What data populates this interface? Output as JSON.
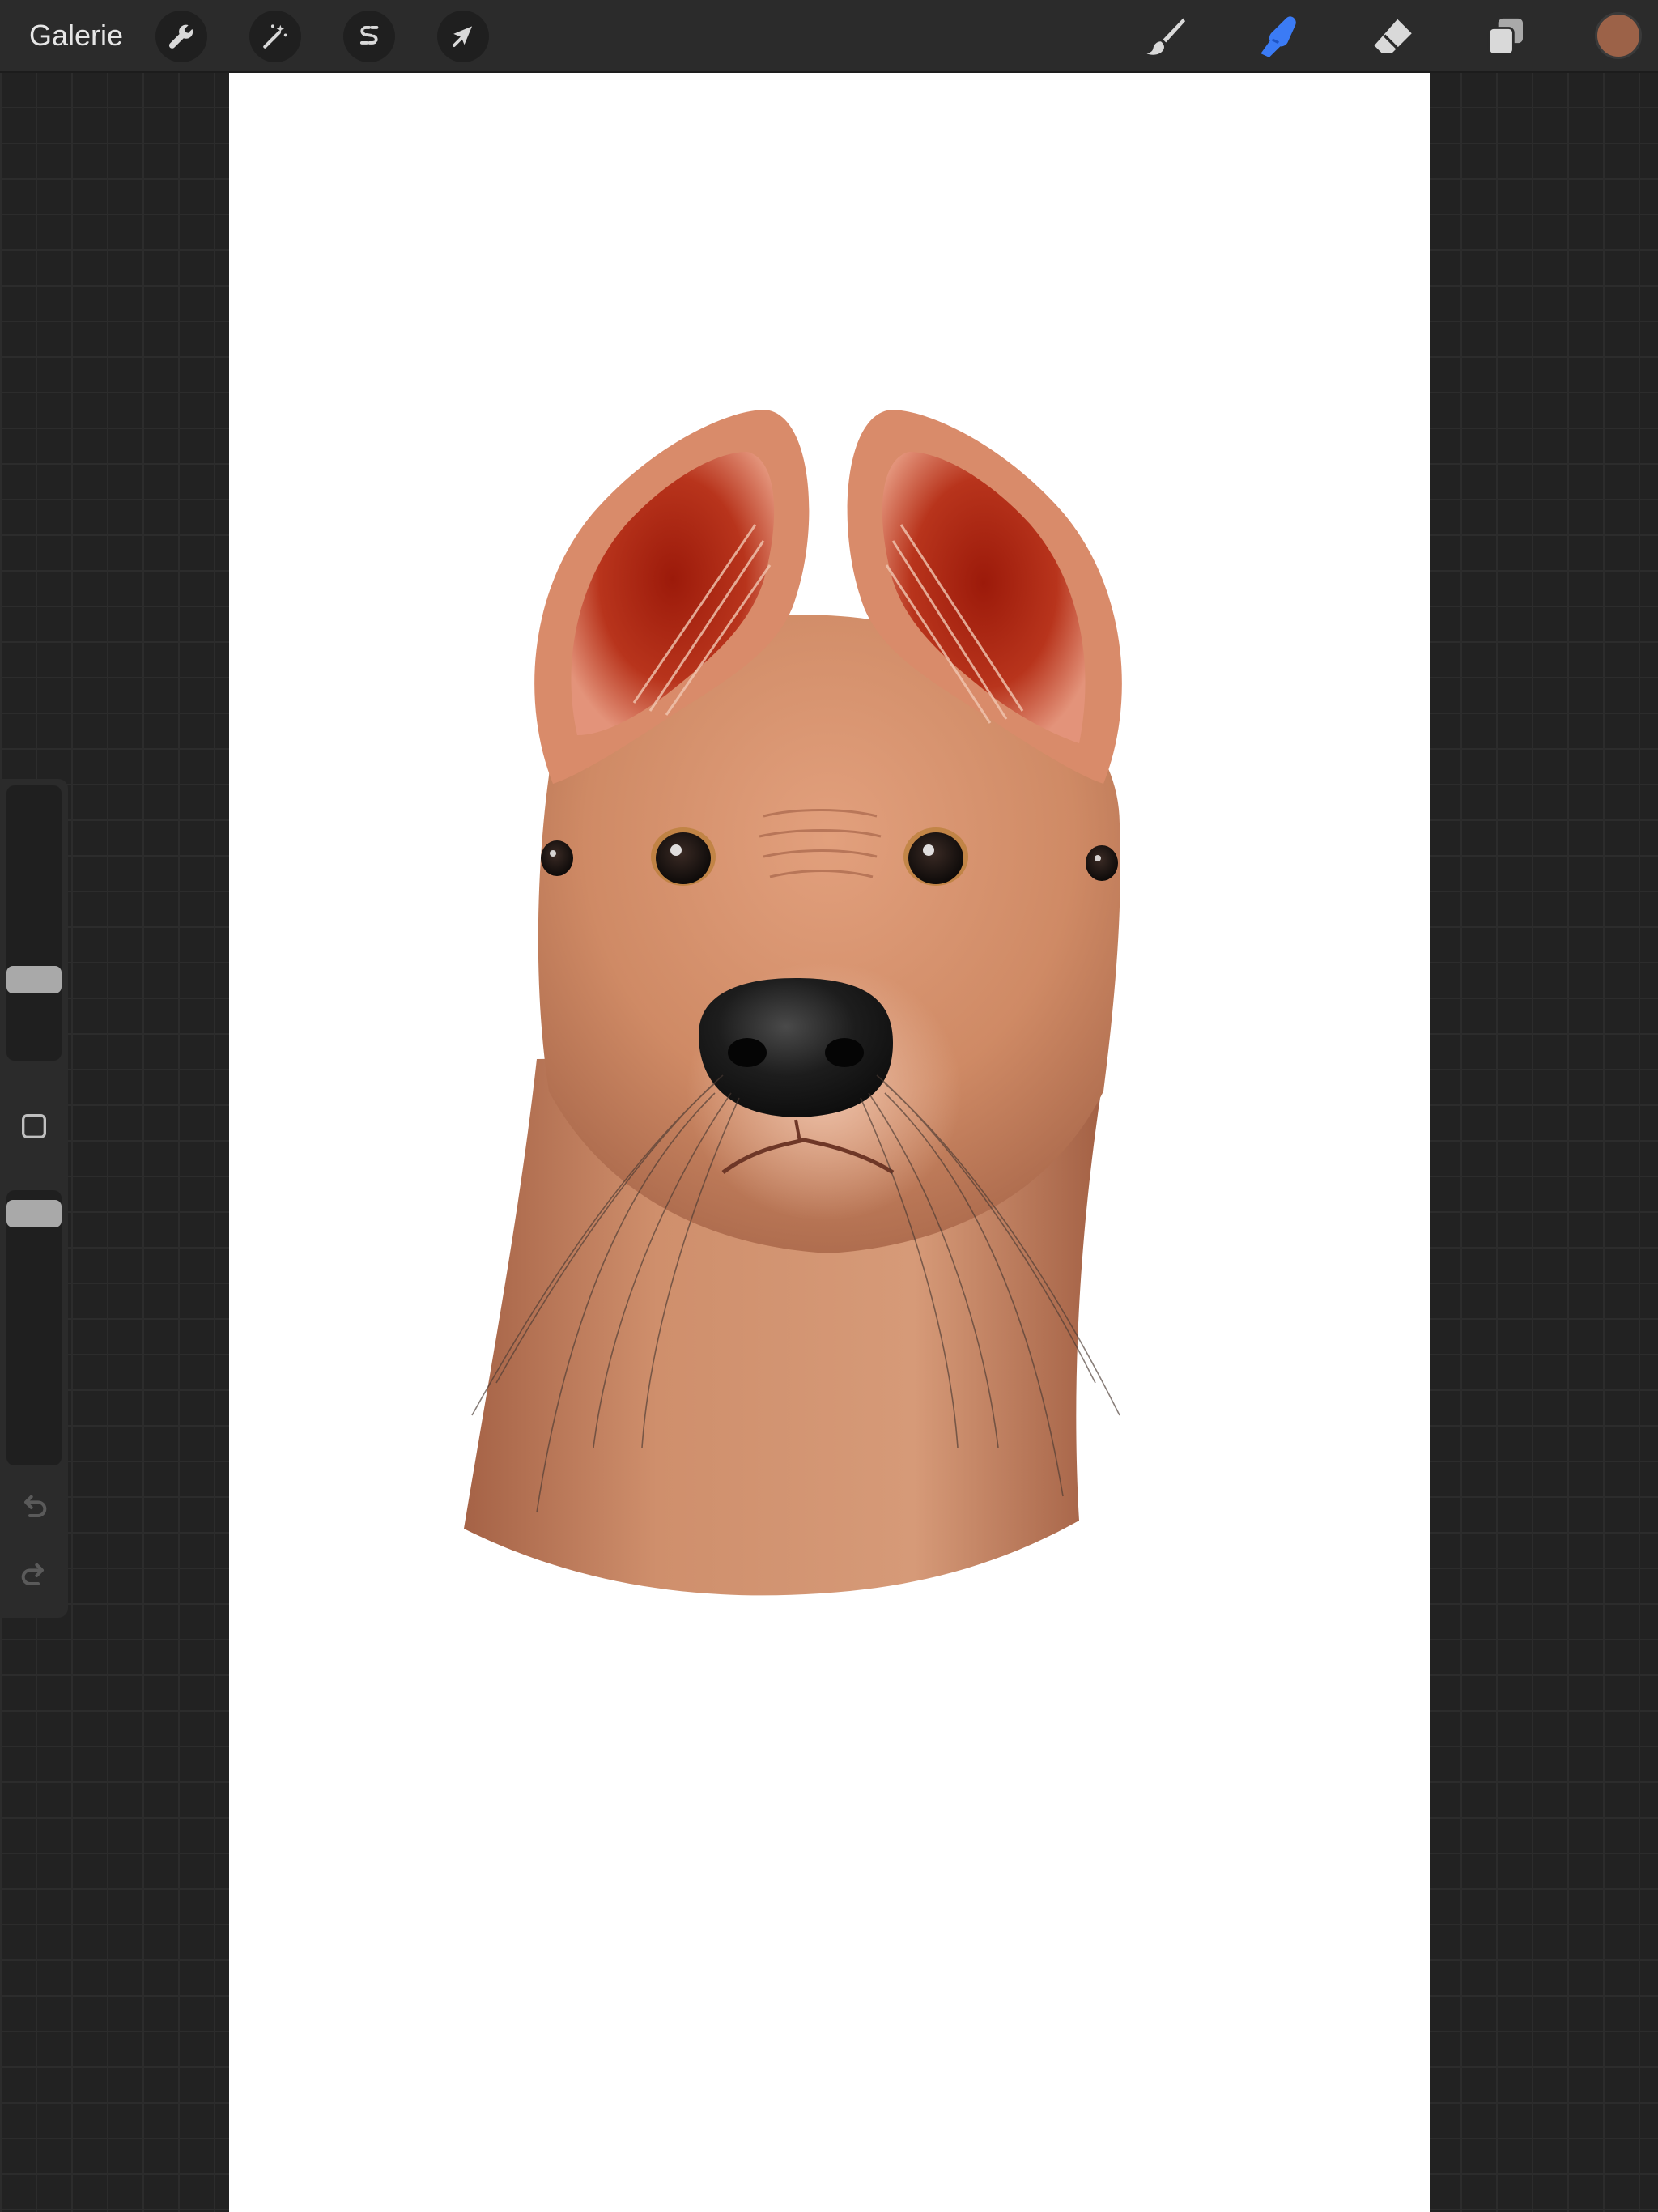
{
  "topbar": {
    "gallery_label": "Galerie",
    "left_tools": [
      {
        "name": "actions",
        "icon": "wrench-icon"
      },
      {
        "name": "adjustments",
        "icon": "magic-wand-icon"
      },
      {
        "name": "selection",
        "icon": "selection-s-icon"
      },
      {
        "name": "transform",
        "icon": "arrow-cursor-icon"
      }
    ],
    "right_tools": [
      {
        "name": "brush",
        "icon": "brush-icon",
        "active": false
      },
      {
        "name": "smudge",
        "icon": "smudge-finger-icon",
        "active": true
      },
      {
        "name": "eraser",
        "icon": "eraser-icon",
        "active": false
      },
      {
        "name": "layers",
        "icon": "layers-icon",
        "active": false
      }
    ],
    "current_color": "#9c6248"
  },
  "sidebar": {
    "brush_size_level": 0.27,
    "opacity_level": 0.96,
    "modifier_icon": "square-modifier-icon",
    "undo_icon": "undo-arrow-icon",
    "redo_icon": "redo-arrow-icon"
  },
  "colors": {
    "accent_active": "#3b7bf5",
    "toolbar_bg": "#2b2b2b",
    "workspace_bg": "#222222",
    "icon_default": "#d9d9d9"
  },
  "canvas": {
    "subject": "dog-head-illustration"
  }
}
